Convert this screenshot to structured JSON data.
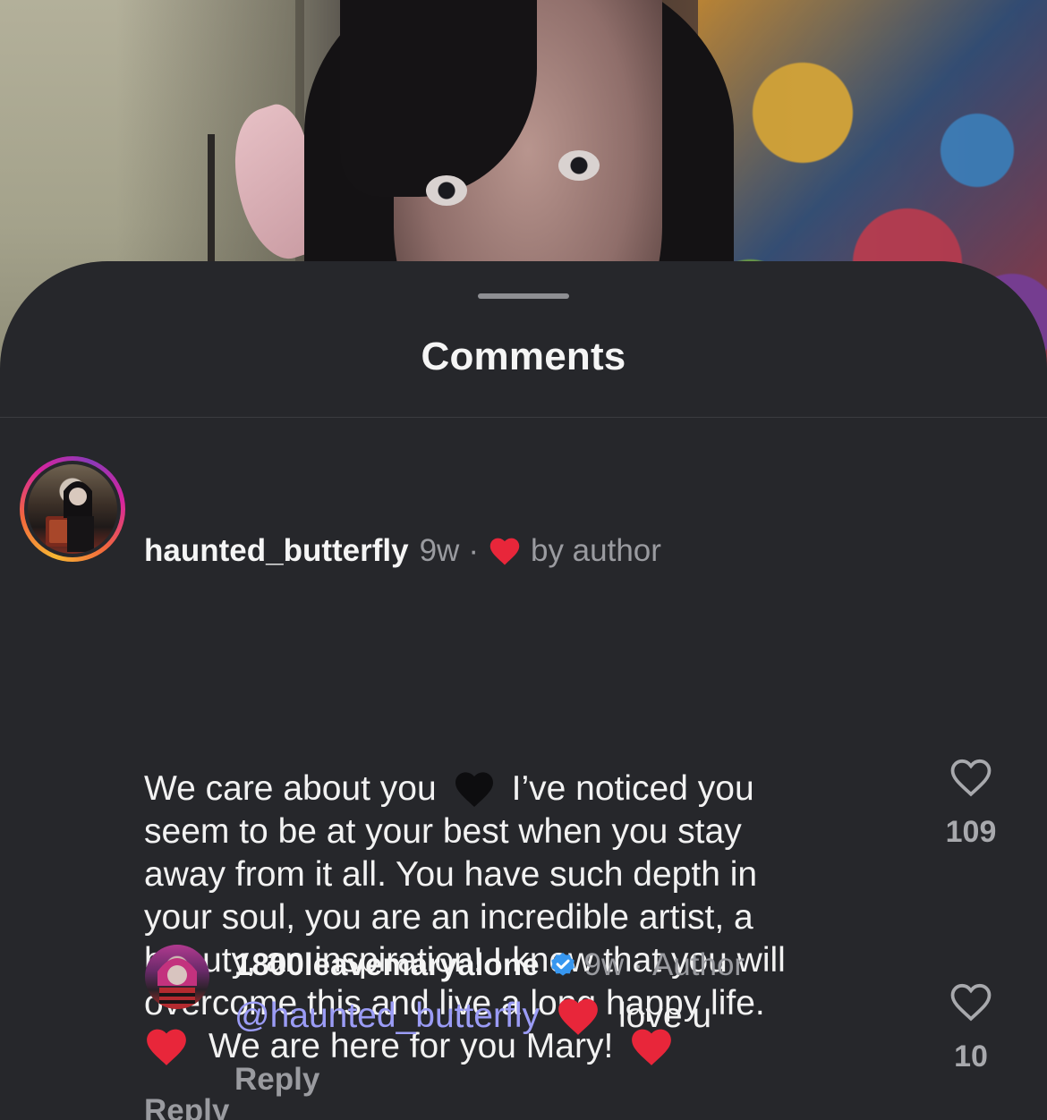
{
  "sheet": {
    "title": "Comments"
  },
  "comments": [
    {
      "username": "haunted_butterfly",
      "age": "9w",
      "dot": "·",
      "author_like_label": "by author",
      "lines": [
        "We care about you",
        "I’ve noticed you",
        "seem to be at your best when you stay",
        "away from it all. You have such depth in",
        "your soul, you are an incredible artist, a",
        "beauty, an inspiration! I know that you will",
        "overcome this and live a long happy life.",
        "We are here for you Mary!"
      ],
      "reply_label": "Reply",
      "like_count": "109"
    },
    {
      "username": "1800leavemaryalone",
      "age": "9w",
      "dot": "·",
      "badge": "Author",
      "mention": "@haunted_butterfly",
      "text": "love u",
      "reply_label": "Reply",
      "like_count": "10"
    }
  ],
  "colors": {
    "sheet_bg": "#26272b",
    "mention": "#9b9cf6",
    "heart_red": "#e8263a",
    "verified_blue": "#3797f0"
  },
  "icons": [
    "heart-outline-icon",
    "red-heart-emoji",
    "black-heart-emoji",
    "verified-badge-icon"
  ]
}
